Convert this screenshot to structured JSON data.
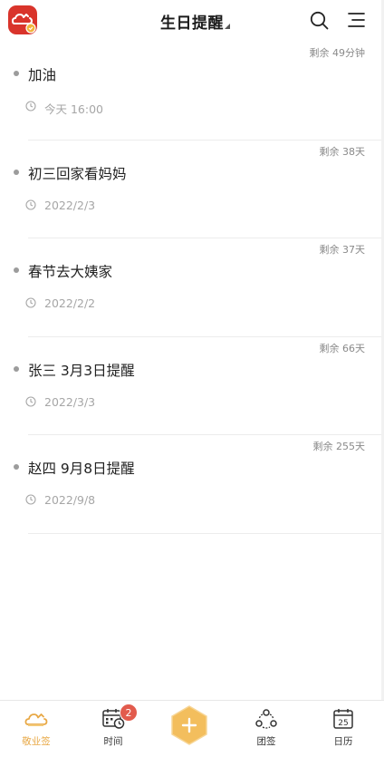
{
  "header": {
    "title": "生日提醒",
    "logo_icon": "cloud-logo-icon",
    "search_icon": "search-icon",
    "menu_icon": "menu-icon"
  },
  "reminders": [
    {
      "name": "加油",
      "date": "今天 16:00",
      "remaining": "剩余 49分钟"
    },
    {
      "name": "初三回家看妈妈",
      "date": "2022/2/3",
      "remaining": "剩余 38天"
    },
    {
      "name": "春节去大姨家",
      "date": "2022/2/2",
      "remaining": "剩余 37天"
    },
    {
      "name": "张三 3月3日提醒",
      "date": "2022/3/3",
      "remaining": "剩余 66天"
    },
    {
      "name": "赵四 9月8日提醒",
      "date": "2022/9/8",
      "remaining": "剩余 255天"
    }
  ],
  "tabbar": {
    "tabs": [
      {
        "label": "敬业签",
        "icon": "cloud-icon",
        "active": true
      },
      {
        "label": "时间",
        "icon": "calendar-clock-icon",
        "active": false
      },
      {
        "label": "团签",
        "icon": "team-icon",
        "active": false
      },
      {
        "label": "日历",
        "icon": "calendar-icon",
        "active": false
      }
    ],
    "time_badge": "2",
    "add_icon": "plus-icon",
    "calendar_day": "25"
  },
  "colors": {
    "accent": "#e8a845",
    "badge": "#e25b4d",
    "logo": "#d9342b"
  }
}
